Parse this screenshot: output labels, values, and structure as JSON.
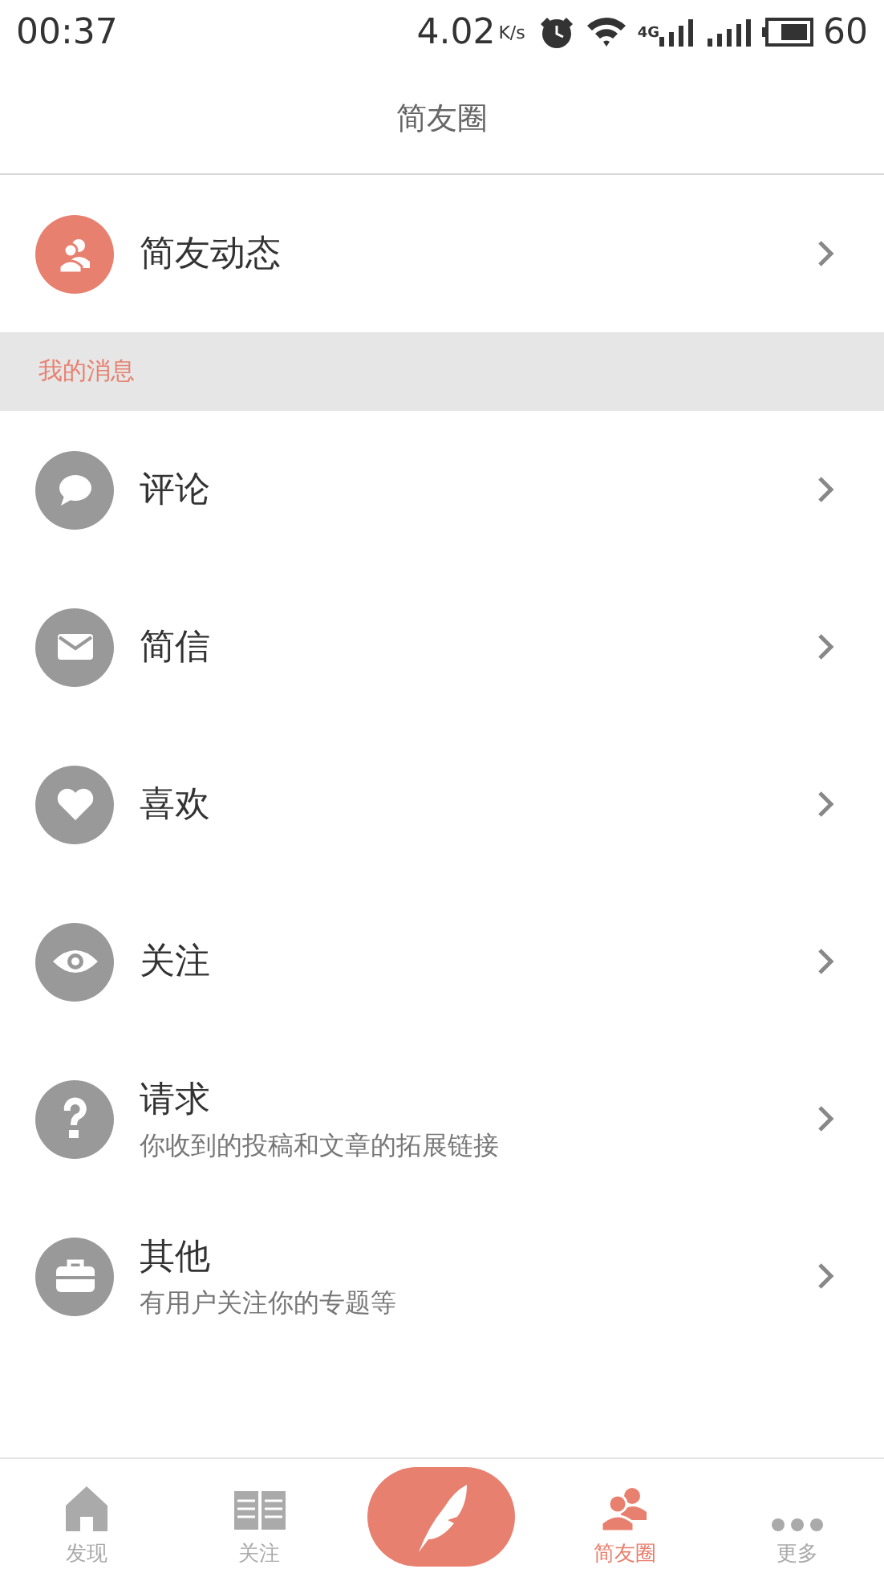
{
  "status_bar": {
    "time": "00:37",
    "speed": "4.02",
    "speed_unit": "K/s",
    "network": "4G",
    "battery": "60"
  },
  "title": "简友圈",
  "feed": {
    "label": "简友动态"
  },
  "section": "我的消息",
  "items": [
    {
      "label": "评论",
      "kind": "comment"
    },
    {
      "label": "简信",
      "kind": "mail"
    },
    {
      "label": "喜欢",
      "kind": "heart"
    },
    {
      "label": "关注",
      "kind": "eye"
    },
    {
      "label": "请求",
      "kind": "question",
      "subtitle": "你收到的投稿和文章的拓展链接"
    },
    {
      "label": "其他",
      "kind": "briefcase",
      "subtitle": "有用户关注你的专题等"
    }
  ],
  "nav": [
    {
      "kind": "home",
      "label": "发现",
      "selected": false
    },
    {
      "kind": "book",
      "label": "关注",
      "selected": false
    },
    {
      "kind": "compose",
      "selected": false
    },
    {
      "kind": "people",
      "label": "简友圈",
      "selected": true
    },
    {
      "kind": "more",
      "label": "更多",
      "selected": false
    }
  ]
}
